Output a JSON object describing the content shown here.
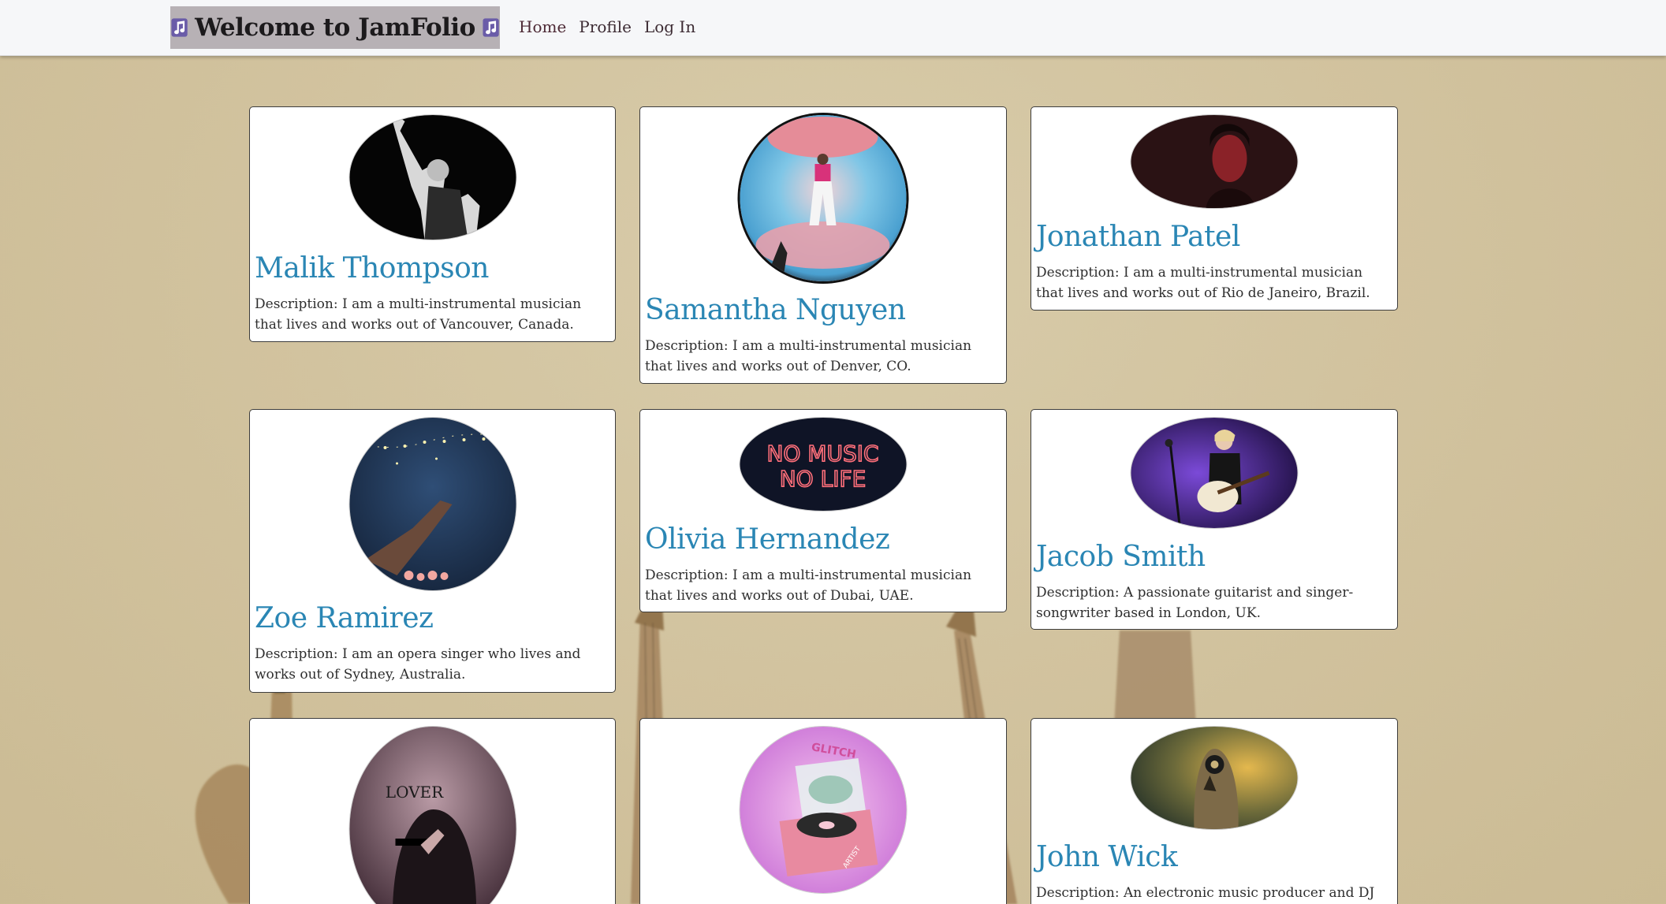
{
  "navbar": {
    "brand": "Welcome to JamFolio",
    "links": [
      "Home",
      "Profile",
      "Log In"
    ]
  },
  "colors": {
    "background": "#d2c39f",
    "navbar": "#f6f7f9",
    "brand_box": "#b7b1b5",
    "name_text": "#2a86b4",
    "note_icon": "#6a5ca8"
  },
  "musicians": [
    {
      "name": "Malik Thompson",
      "description": "Description: I am a multi-instrumental musician that lives and works out of Vancouver, Canada.",
      "image": "singer-on-stage-photo"
    },
    {
      "name": "Samantha Nguyen",
      "description": "Description: I am a multi-instrumental musician that lives and works out of Denver, CO.",
      "image": "figure-in-glass-sphere-photo"
    },
    {
      "name": "Jonathan Patel",
      "description": "Description: I am a multi-instrumental musician that lives and works out of Rio de Janeiro, Brazil.",
      "image": "red-lit-portrait-photo"
    },
    {
      "name": "Zoe Ramirez",
      "description": "Description: I am an opera singer who lives and works out of Sydney, Australia.",
      "image": "hand-reaching-night-sky-photo"
    },
    {
      "name": "Olivia Hernandez",
      "description": "Description: I am a multi-instrumental musician that lives and works out of Dubai, UAE.",
      "image": "neon-sign-photo",
      "neon_text": [
        "NO MUSIC",
        "NO LIFE"
      ]
    },
    {
      "name": "Jacob Smith",
      "description": "Description: A passionate guitarist and singer-songwriter based in London, UK.",
      "image": "guitarist-on-stage-photo"
    },
    {
      "name": "",
      "description": "",
      "image": "lover-portrait-photo",
      "image_text": "LOVER"
    },
    {
      "name": "",
      "description": "",
      "image": "record-player-artwork",
      "image_text": [
        "GLITCH",
        "ARTIST"
      ]
    },
    {
      "name": "John Wick",
      "description": "Description: An electronic music producer and DJ from",
      "image": "hooded-figure-photo"
    }
  ]
}
